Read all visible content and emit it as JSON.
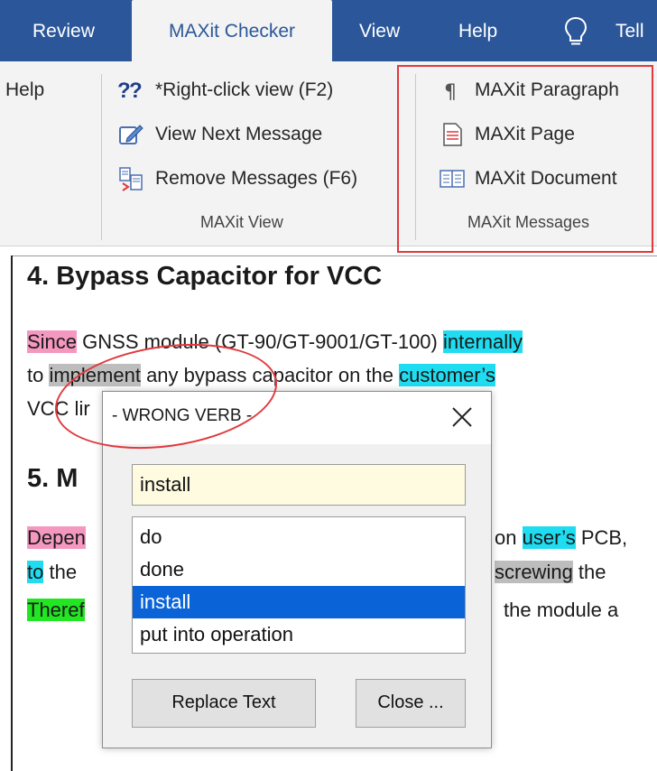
{
  "ribbon_tabs": [
    {
      "label": "Review"
    },
    {
      "label": "MAXit Checker",
      "active": true
    },
    {
      "label": "View"
    },
    {
      "label": "Help"
    },
    {
      "label": "Tell"
    }
  ],
  "ribbon": {
    "help_label": "Help",
    "view_group": {
      "items": [
        {
          "label": "*Right-click view (F2)",
          "icon": "question-icon"
        },
        {
          "label": "View Next Message",
          "icon": "edit-icon"
        },
        {
          "label": "Remove Messages (F6)",
          "icon": "remove-messages-icon"
        }
      ],
      "group_label": "MAXit View"
    },
    "messages_group": {
      "items": [
        {
          "label": "MAXit Paragraph",
          "icon": "paragraph-icon"
        },
        {
          "label": "MAXit Page",
          "icon": "page-icon"
        },
        {
          "label": "MAXit Document",
          "icon": "document-icon"
        }
      ],
      "group_label": "MAXit Messages"
    }
  },
  "document": {
    "heading4": "4.  Bypass Capacitor for VCC",
    "p4": {
      "l1": {
        "since": "Since",
        "rest": " GNSS module (GT-90/GT-9001/GT-100) ",
        "internally": "internally"
      },
      "l2": {
        "to": "to ",
        "implement": "implement",
        "rest": " any bypass capacitor on the ",
        "customers": "customer’s"
      },
      "l3": "VCC lir"
    },
    "heading5": "5.  M",
    "p5": {
      "l1": {
        "depen": "Depen",
        "on": "on ",
        "users": "user’s",
        "pcb": " PCB,"
      },
      "l2": {
        "to": "to",
        "the": " the",
        "screwing": "screwing",
        "the2": " the"
      },
      "l3": {
        "theref": "Theref",
        "rest": "the module a"
      }
    }
  },
  "dialog": {
    "title": "- WRONG VERB -",
    "input_value": "install",
    "suggestions": [
      "do",
      "done",
      "install",
      "put into operation"
    ],
    "selected_index": 2,
    "replace_label": "Replace Text",
    "close_label": "Close ..."
  },
  "colors": {
    "ribbon_blue": "#2b579a",
    "highlight_pink": "#f598c0",
    "highlight_cyan": "#1fdcf0",
    "highlight_gray": "#bdbdbd",
    "highlight_green": "#22e622",
    "selection_blue": "#0a64d8",
    "annotation_red": "#e0393e"
  }
}
